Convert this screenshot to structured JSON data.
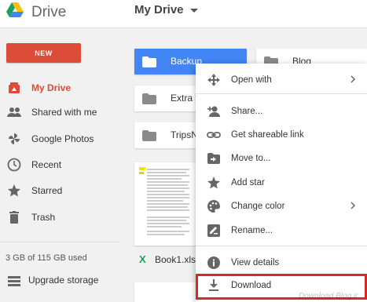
{
  "header": {
    "app_title": "Drive",
    "breadcrumb": "My Drive"
  },
  "sidebar": {
    "new_label": "NEW",
    "items": [
      {
        "label": "My Drive",
        "icon": "my-drive-icon",
        "active": true
      },
      {
        "label": "Shared with me",
        "icon": "people-icon"
      },
      {
        "label": "Google Photos",
        "icon": "pinwheel-icon"
      },
      {
        "label": "Recent",
        "icon": "clock-icon"
      },
      {
        "label": "Starred",
        "icon": "star-icon"
      },
      {
        "label": "Trash",
        "icon": "trash-icon"
      }
    ],
    "storage": "3 GB of 115 GB used",
    "upgrade_label": "Upgrade storage"
  },
  "main": {
    "folders": [
      {
        "name": "Backup",
        "selected": true
      },
      {
        "name": "Blog"
      },
      {
        "name": "Extra f"
      },
      {
        "name": "TripsN"
      }
    ],
    "file_name": "Book1.xlsx"
  },
  "context_menu": {
    "items": [
      {
        "label": "Open with",
        "icon": "open-with-icon",
        "submenu": true
      },
      {
        "label": "Share...",
        "icon": "share-person-icon"
      },
      {
        "label": "Get shareable link",
        "icon": "link-icon"
      },
      {
        "label": "Move to...",
        "icon": "move-folder-icon"
      },
      {
        "label": "Add star",
        "icon": "star-icon"
      },
      {
        "label": "Change color",
        "icon": "palette-icon",
        "submenu": true
      },
      {
        "label": "Rename...",
        "icon": "rename-icon"
      },
      {
        "label": "View details",
        "icon": "info-icon"
      },
      {
        "label": "Download",
        "icon": "download-icon",
        "highlighted": true
      }
    ]
  },
  "colors": {
    "brand_red": "#dd4b39",
    "selected_blue": "#4285f4",
    "highlight_border": "#d62828"
  },
  "watermark": "Download.Blog.ir"
}
